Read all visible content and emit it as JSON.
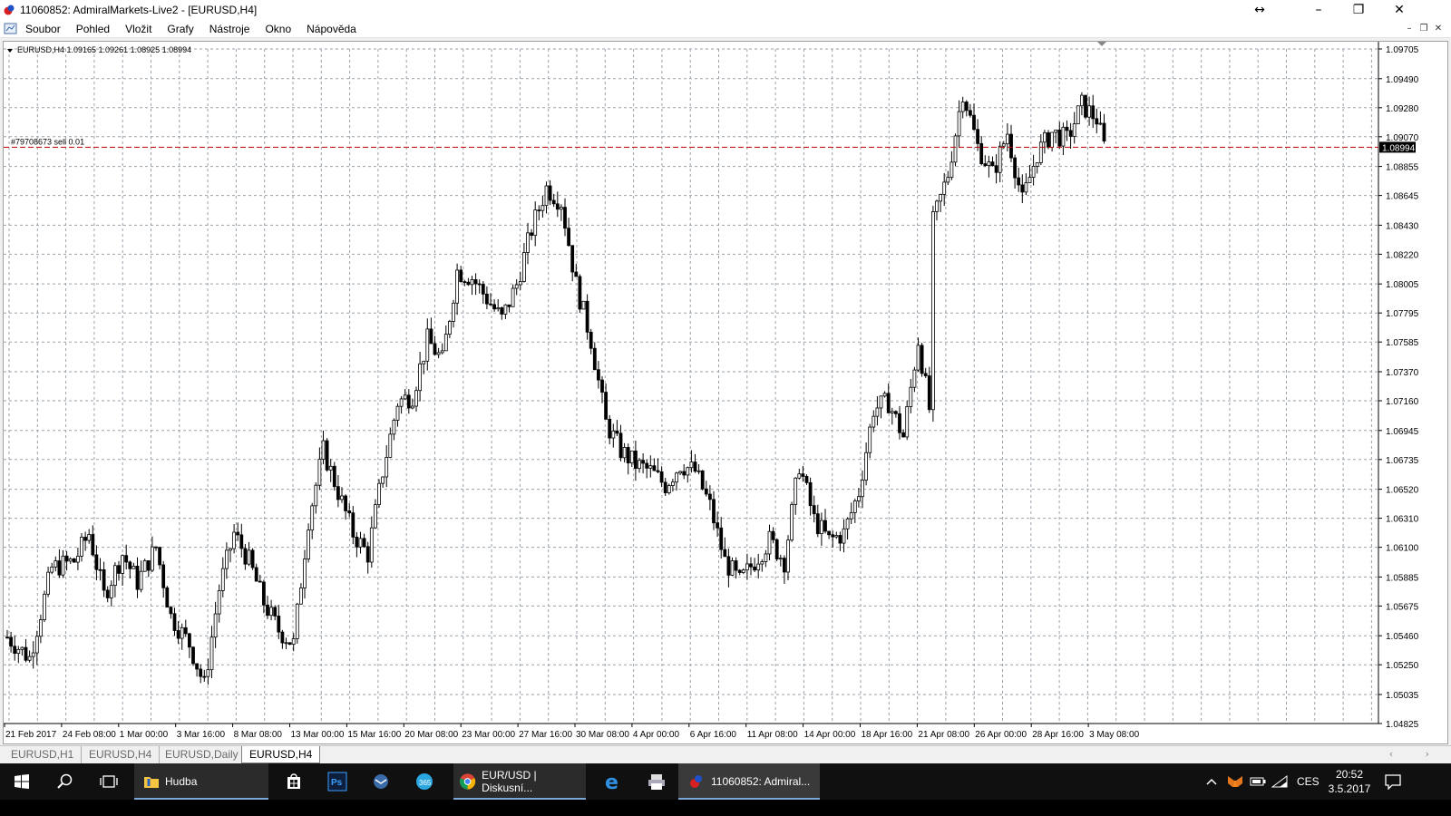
{
  "window": {
    "title": "11060852: AdmiralMarkets-Live2 - [EURUSD,H4]",
    "controls": {
      "resize": "↔",
      "minimize": "–",
      "restore": "❐",
      "close": "✕"
    }
  },
  "menu": {
    "items": [
      "Soubor",
      "Pohled",
      "Vložit",
      "Grafy",
      "Nástroje",
      "Okno",
      "Nápověda"
    ],
    "mdi_controls": {
      "minimize": "–",
      "restore": "❐",
      "close": "✕"
    }
  },
  "chart_data": {
    "type": "candlestick",
    "symbol_header": "EURUSD,H4  1.09165 1.09261 1.08925 1.08994",
    "timeframe": "H4",
    "yticks": [
      "1.09705",
      "1.09490",
      "1.09280",
      "1.09070",
      "1.08855",
      "1.08645",
      "1.08430",
      "1.08220",
      "1.08005",
      "1.07795",
      "1.07585",
      "1.07370",
      "1.07160",
      "1.06945",
      "1.06735",
      "1.06520",
      "1.06310",
      "1.06100",
      "1.05885",
      "1.05675",
      "1.05460",
      "1.05250",
      "1.05035",
      "1.04825"
    ],
    "ylim": [
      1.04825,
      1.09705
    ],
    "current_price": "1.08994",
    "order_label": "#79708673 sell 0.01",
    "order_price": 1.08994,
    "xticks": [
      "21 Feb 2017",
      "24 Feb 08:00",
      "1 Mar 00:00",
      "3 Mar 16:00",
      "8 Mar 08:00",
      "13 Mar 00:00",
      "15 Mar 16:00",
      "20 Mar 08:00",
      "23 Mar 00:00",
      "27 Mar 16:00",
      "30 Mar 08:00",
      "4 Apr 00:00",
      "6 Apr 16:00",
      "11 Apr 08:00",
      "14 Apr 00:00",
      "18 Apr 16:00",
      "21 Apr 08:00",
      "26 Apr 00:00",
      "28 Apr 16:00",
      "3 May 08:00"
    ],
    "close_path": [
      [
        0,
        1.0545
      ],
      [
        6,
        1.053
      ],
      [
        12,
        1.0595
      ],
      [
        18,
        1.06
      ],
      [
        22,
        1.062
      ],
      [
        26,
        1.0575
      ],
      [
        31,
        1.0605
      ],
      [
        35,
        1.0585
      ],
      [
        40,
        1.061
      ],
      [
        44,
        1.056
      ],
      [
        49,
        1.054
      ],
      [
        53,
        1.051
      ],
      [
        57,
        1.058
      ],
      [
        61,
        1.062
      ],
      [
        65,
        1.06
      ],
      [
        69,
        1.057
      ],
      [
        73,
        1.055
      ],
      [
        77,
        1.054
      ],
      [
        81,
        1.063
      ],
      [
        85,
        1.068
      ],
      [
        89,
        1.065
      ],
      [
        93,
        1.062
      ],
      [
        97,
        1.0605
      ],
      [
        101,
        1.0665
      ],
      [
        105,
        1.0715
      ],
      [
        109,
        1.072
      ],
      [
        113,
        1.076
      ],
      [
        117,
        1.0745
      ],
      [
        121,
        1.081
      ],
      [
        125,
        1.0805
      ],
      [
        129,
        1.079
      ],
      [
        133,
        1.0775
      ],
      [
        137,
        1.08
      ],
      [
        141,
        1.084
      ],
      [
        145,
        1.087
      ],
      [
        149,
        1.086
      ],
      [
        153,
        1.08
      ],
      [
        157,
        1.076
      ],
      [
        161,
        1.07
      ],
      [
        165,
        1.068
      ],
      [
        169,
        1.067
      ],
      [
        173,
        1.0665
      ],
      [
        177,
        1.0655
      ],
      [
        181,
        1.067
      ],
      [
        185,
        1.0665
      ],
      [
        189,
        1.064
      ],
      [
        193,
        1.06
      ],
      [
        197,
        1.0585
      ],
      [
        201,
        1.06
      ],
      [
        205,
        1.0615
      ],
      [
        209,
        1.06
      ],
      [
        213,
        1.067
      ],
      [
        217,
        1.063
      ],
      [
        221,
        1.0615
      ],
      [
        225,
        1.062
      ],
      [
        229,
        1.065
      ],
      [
        233,
        1.071
      ],
      [
        237,
        1.0715
      ],
      [
        241,
        1.069
      ],
      [
        245,
        1.076
      ],
      [
        248,
        1.071
      ],
      [
        249,
        1.0845
      ],
      [
        253,
        1.088
      ],
      [
        257,
        1.094
      ],
      [
        261,
        1.09
      ],
      [
        265,
        1.088
      ],
      [
        269,
        1.091
      ],
      [
        273,
        1.086
      ],
      [
        277,
        1.0895
      ],
      [
        281,
        1.091
      ],
      [
        285,
        1.0905
      ],
      [
        289,
        1.093
      ],
      [
        293,
        1.092
      ],
      [
        295,
        1.09
      ]
    ],
    "grid": true,
    "background": "#ffffff",
    "candle_color": "#000000",
    "order_line_color": "#c00000"
  },
  "tabs": {
    "items": [
      "EURUSD,H1",
      "EURUSD,H4",
      "EURUSD,Daily",
      "EURUSD,H4"
    ],
    "active_index": 3,
    "scroll_arrows": "‹ ›"
  },
  "taskbar": {
    "start_icon": "windows-icon",
    "search_icon": "search-icon",
    "taskview_icon": "task-view-icon",
    "apps": [
      {
        "label": "Hudba",
        "icon": "folder-icon"
      },
      {
        "label": "EUR/USD | Diskusní...",
        "icon": "chrome-icon"
      },
      {
        "label": "11060852: Admiral...",
        "icon": "metatrader-icon"
      }
    ],
    "pinned": [
      "store-icon",
      "photoshop-icon",
      "mail-icon",
      "skype-icon",
      "edge-icon",
      "printer-icon"
    ],
    "tray": {
      "language": "CES",
      "time": "20:52",
      "date": "3.5.2017"
    }
  },
  "colors": {
    "taskbar_bg": "#101010",
    "accent_underline": "#7aa7d8",
    "grid_color": "#9aa2aa",
    "price_label_bg": "#000000"
  }
}
